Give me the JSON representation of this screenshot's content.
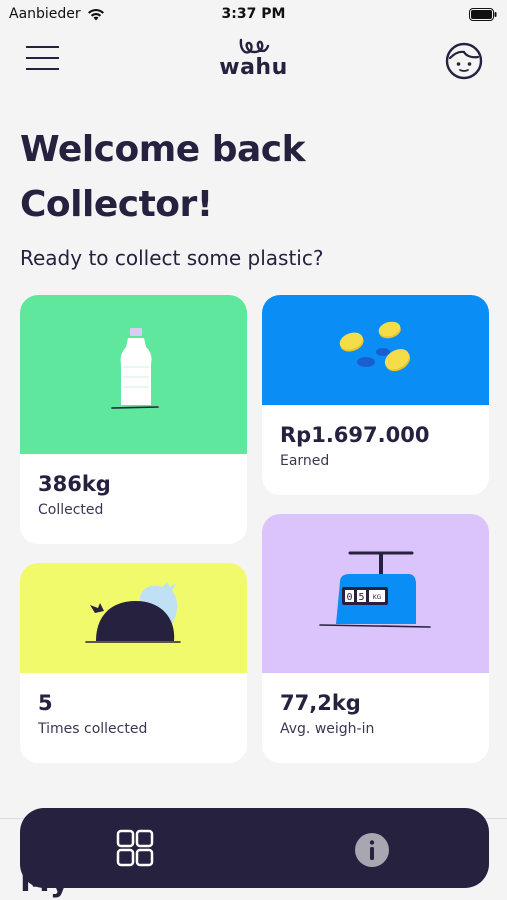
{
  "status_bar": {
    "carrier": "Aanbieder",
    "time": "3:37 PM"
  },
  "header": {
    "logo_text": "wahu",
    "menu_icon": "hamburger-menu-icon",
    "profile_icon": "profile-face-icon"
  },
  "welcome": {
    "title_line1": "Welcome back",
    "title_line2": "Collector!",
    "subtitle": "Ready to collect some plastic?"
  },
  "cards": {
    "collected": {
      "value": "386kg",
      "label": "Collected",
      "color": "#5ee79d",
      "icon": "plastic-bottle-icon"
    },
    "earned": {
      "value": "Rp1.697.000",
      "label": "Earned",
      "color": "#0a8df5",
      "icon": "coins-icon"
    },
    "times": {
      "value": "5",
      "label": "Times collected",
      "color": "#f1fa6b",
      "icon": "trash-bags-icon"
    },
    "weighin": {
      "value": "77,2kg",
      "label": "Avg. weigh-in",
      "color": "#dbc3fb",
      "icon": "scale-icon",
      "display_digits": [
        "0",
        "5"
      ],
      "display_unit": "KG"
    }
  },
  "peek_title": "My",
  "bottom_nav": {
    "background": "#26213f",
    "items": [
      {
        "icon": "dashboard-grid-icon"
      },
      {
        "icon": "info-icon"
      }
    ]
  }
}
